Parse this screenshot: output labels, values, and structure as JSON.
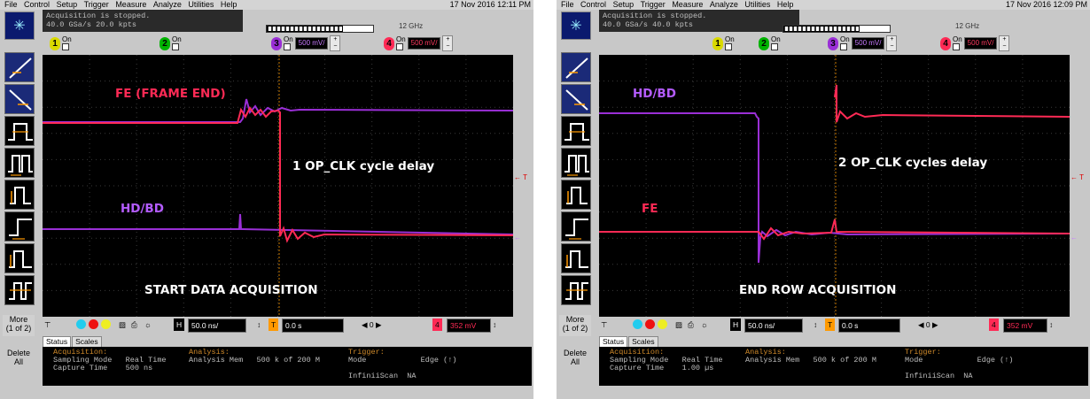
{
  "menu": [
    "File",
    "Control",
    "Setup",
    "Trigger",
    "Measure",
    "Analyze",
    "Utilities",
    "Help"
  ],
  "colors": {
    "ch1": "#d9d900",
    "ch2": "#00b300",
    "ch3": "#9a2fd6",
    "ch4": "#ff2a55",
    "grid": "#3a3a3a",
    "screen": "#000000"
  },
  "icons": [
    "home-icon",
    "rising-edge-icon",
    "falling-edge-icon",
    "pulse-icon",
    "pulse-icon",
    "pulse-icon",
    "pulse-icon",
    "pulse-icon",
    "pulse-icon"
  ],
  "screens": [
    {
      "datetime": "17 Nov 2016 12:11 PM",
      "acq_status_1": "Acquisition is stopped.",
      "acq_status_2": "40.0 GSa/s   20.0 kpts",
      "bandwidth": "12 GHz",
      "ch1_on": "On",
      "ch2_on": "On",
      "ch3_on": "On",
      "ch4_on": "On",
      "ch3_scale": "500 mV/",
      "ch4_scale": "500 mV/",
      "timebase": "50.0 ns/",
      "delay": "0.0 s",
      "trigger_level": "352 mV",
      "tabs": [
        "Status",
        "Scales"
      ],
      "more_button": "More\n(1 of 2)",
      "delete_all": "Delete\nAll",
      "acquisition_header": "Acquisition:",
      "sampling_mode": "Sampling Mode   Real Time",
      "capture_time": "Capture Time    500 ns",
      "analysis_header": "Analysis:",
      "analysis_mem": "Analysis Mem   500 k of 200 M",
      "trigger_header": "Trigger:",
      "trigger_mode": "Mode            Edge (↑)",
      "infiniscan": "InfiniiScan  NA",
      "labels": {
        "top": "FE (FRAME END)",
        "middle": "1 OP_CLK cycle delay",
        "lower": "HD/BD",
        "bottom": "START DATA ACQUISITION"
      }
    },
    {
      "datetime": "17 Nov 2016 12:09 PM",
      "acq_status_1": "Acquisition is stopped.",
      "acq_status_2": "40.0 GSa/s   40.0 kpts",
      "bandwidth": "12 GHz",
      "ch1_on": "On",
      "ch2_on": "On",
      "ch3_on": "On",
      "ch4_on": "On",
      "ch3_scale": "500 mV/",
      "ch4_scale": "500 mV/",
      "timebase": "50.0 ns/",
      "delay": "0.0 s",
      "trigger_level": "352 mV",
      "tabs": [
        "Status",
        "Scales"
      ],
      "more_button": "More\n(1 of 2)",
      "delete_all": "Delete\nAll",
      "acquisition_header": "Acquisition:",
      "sampling_mode": "Sampling Mode   Real Time",
      "capture_time": "Capture Time    1.00 µs",
      "analysis_header": "Analysis:",
      "analysis_mem": "Analysis Mem   500 k of 200 M",
      "trigger_header": "Trigger:",
      "trigger_mode": "Mode            Edge (↑)",
      "infiniscan": "InfiniiScan  NA",
      "labels": {
        "top": "HD/BD",
        "middle": "2 OP_CLK cycles delay",
        "lower": "FE",
        "bottom": "END ROW ACQUISITION"
      }
    }
  ]
}
